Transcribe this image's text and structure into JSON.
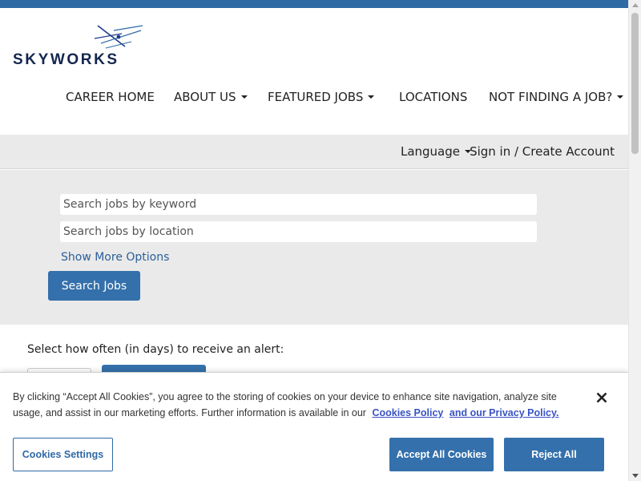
{
  "logo": {
    "text": "SKYWORKS"
  },
  "nav": {
    "items": [
      {
        "label": "CAREER HOME",
        "dropdown": false
      },
      {
        "label": "ABOUT US",
        "dropdown": true
      },
      {
        "label": "FEATURED JOBS",
        "dropdown": true
      },
      {
        "label": "LOCATIONS",
        "dropdown": false
      },
      {
        "label": "NOT FINDING A JOB?",
        "dropdown": true
      }
    ]
  },
  "utility": {
    "language_label": "Language",
    "sign_in_label": "Sign in / Create Account"
  },
  "search": {
    "keyword_placeholder": "Search jobs by keyword",
    "location_placeholder": "Search jobs by location",
    "show_more_label": "Show More Options",
    "button_label": "Search Jobs"
  },
  "alert": {
    "label": "Select how often (in days) to receive an alert:"
  },
  "cookie": {
    "text": "By clicking “Accept All Cookies”, you agree to the storing of cookies on your device to enhance site navigation, analyze site usage, and assist in our marketing efforts. Further information is available in our",
    "policy_link": "Cookies Policy",
    "privacy_link": "and our Privacy Policy.",
    "settings_label": "Cookies Settings",
    "accept_label": "Accept All Cookies",
    "reject_label": "Reject All"
  },
  "colors": {
    "brand_blue": "#2f6aa5",
    "button_blue": "#3470ab",
    "logo_navy": "#14264f",
    "panel_gray": "#eaeaea"
  }
}
